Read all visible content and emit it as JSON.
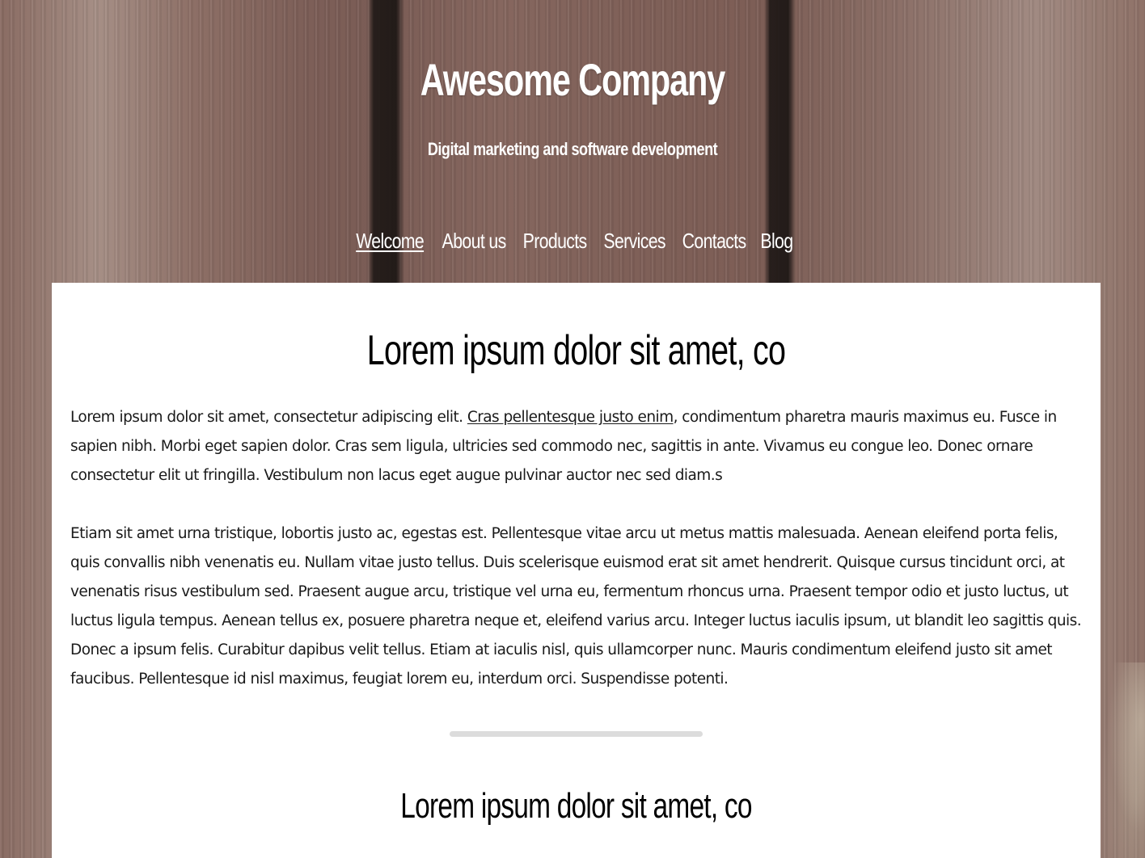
{
  "header": {
    "title": "Awesome Company",
    "tagline": "Digital marketing and software development"
  },
  "nav": {
    "items": [
      {
        "label": "Welcome",
        "active": true
      },
      {
        "label": "About us",
        "active": false
      },
      {
        "label": "Products",
        "active": false
      },
      {
        "label": "Services",
        "active": false
      },
      {
        "label": "Contacts",
        "active": false
      },
      {
        "label": "Blog",
        "active": false
      }
    ]
  },
  "main": {
    "section1": {
      "heading": "Lorem ipsum dolor sit amet, co",
      "p1_before_link": "Lorem ipsum dolor sit amet, consectetur adipiscing elit. ",
      "p1_link": "Cras pellentesque justo enim",
      "p1_after_link": ", condimentum pharetra mauris maximus eu. Fusce in sapien nibh. Morbi eget sapien dolor. Cras sem ligula, ultricies sed commodo nec, sagittis in ante. Vivamus eu congue leo. Donec ornare consectetur elit ut fringilla. Vestibulum non lacus eget augue pulvinar auctor nec sed diam.s",
      "p2": "Etiam sit amet urna tristique, lobortis justo ac, egestas est. Pellentesque vitae arcu ut metus mattis malesuada. Aenean eleifend porta felis, quis convallis nibh venenatis eu. Nullam vitae justo tellus. Duis scelerisque euismod erat sit amet hendrerit. Quisque cursus tincidunt orci, at venenatis risus vestibulum sed. Praesent augue arcu, tristique vel urna eu, fermentum rhoncus urna. Praesent tempor odio et justo luctus, ut luctus ligula tempus. Aenean tellus ex, posuere pharetra neque et, eleifend varius arcu. Integer luctus iaculis ipsum, ut blandit leo sagittis quis. Donec a ipsum felis. Curabitur dapibus velit tellus. Etiam at iaculis nisl, quis ullamcorper nunc. Mauris condimentum eleifend justo sit amet faucibus. Pellentesque id nisl maximus, feugiat lorem eu, interdum orci. Suspendisse potenti."
    },
    "section2": {
      "heading": "Lorem ipsum dolor sit amet, co"
    }
  },
  "colors": {
    "card_background": "#ffffff",
    "header_text": "#ffffff",
    "body_text": "#1a1a1a",
    "divider": "#dcdcdc",
    "wood_base": "#7a5a50"
  }
}
